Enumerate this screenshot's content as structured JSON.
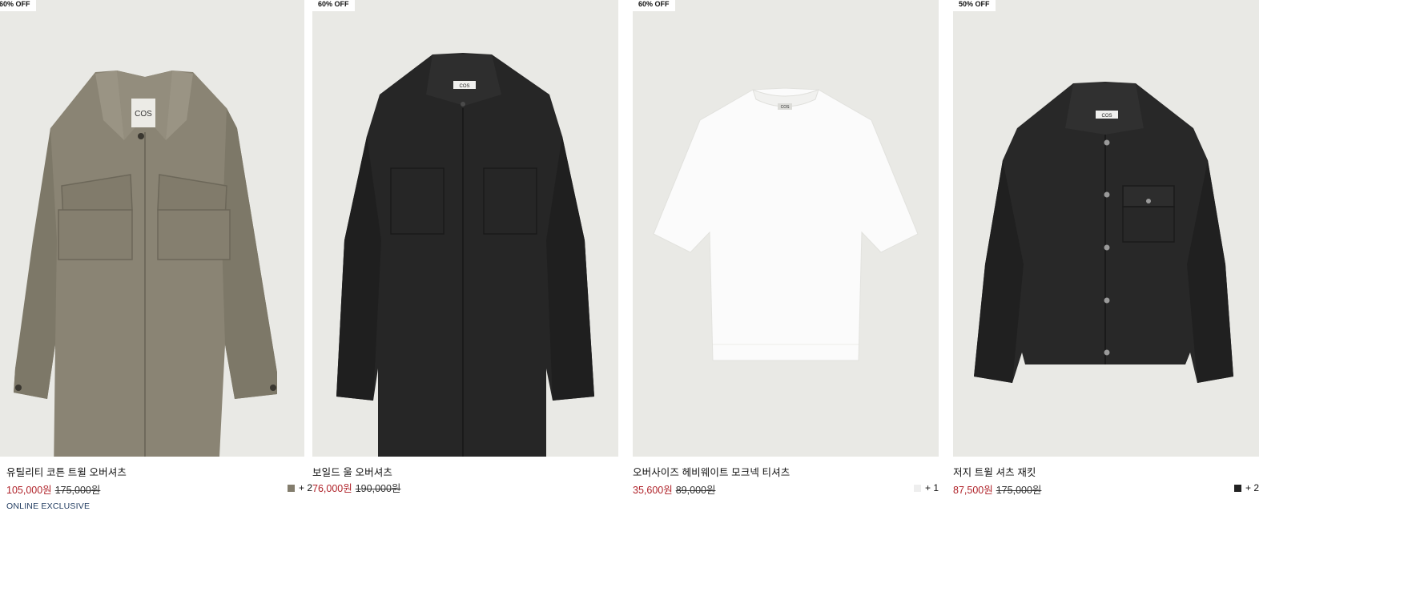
{
  "products": [
    {
      "badge": "60% OFF",
      "name": "유틸리티 코튼 트윌 오버셔츠",
      "sale_price": "105,000원",
      "original_price": "175,000원",
      "swatch_color": "#837d6d",
      "more_colors": "+ 2",
      "tag": "ONLINE EXCLUSIVE",
      "garment_color": "#8a8474",
      "garment_type": "utility-overshirt-icon"
    },
    {
      "badge": "60% OFF",
      "name": "보일드 울 오버셔츠",
      "sale_price": "76,000원",
      "original_price": "190,000원",
      "garment_color": "#262626",
      "garment_type": "wool-overshirt-icon"
    },
    {
      "badge": "60% OFF",
      "name": "오버사이즈 헤비웨이트 모크넥 티셔츠",
      "sale_price": "35,600원",
      "original_price": "89,000원",
      "swatch_color": "#eeeeee",
      "more_colors": "+ 1",
      "garment_color": "#fbfbfb",
      "garment_type": "tshirt-icon"
    },
    {
      "badge": "50% OFF",
      "name": "저지 트윌 셔츠 재킷",
      "sale_price": "87,500원",
      "original_price": "175,000원",
      "swatch_color": "#222222",
      "more_colors": "+ 2",
      "garment_color": "#282828",
      "garment_type": "shirt-jacket-icon"
    }
  ]
}
